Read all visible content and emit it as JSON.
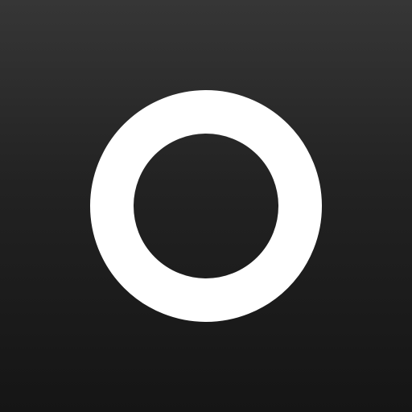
{
  "icon": {
    "name": "ring-logo-icon",
    "shape": "ring",
    "colors": {
      "ring": "#ffffff",
      "background_top": "#363636",
      "background_bottom": "#151515"
    }
  }
}
